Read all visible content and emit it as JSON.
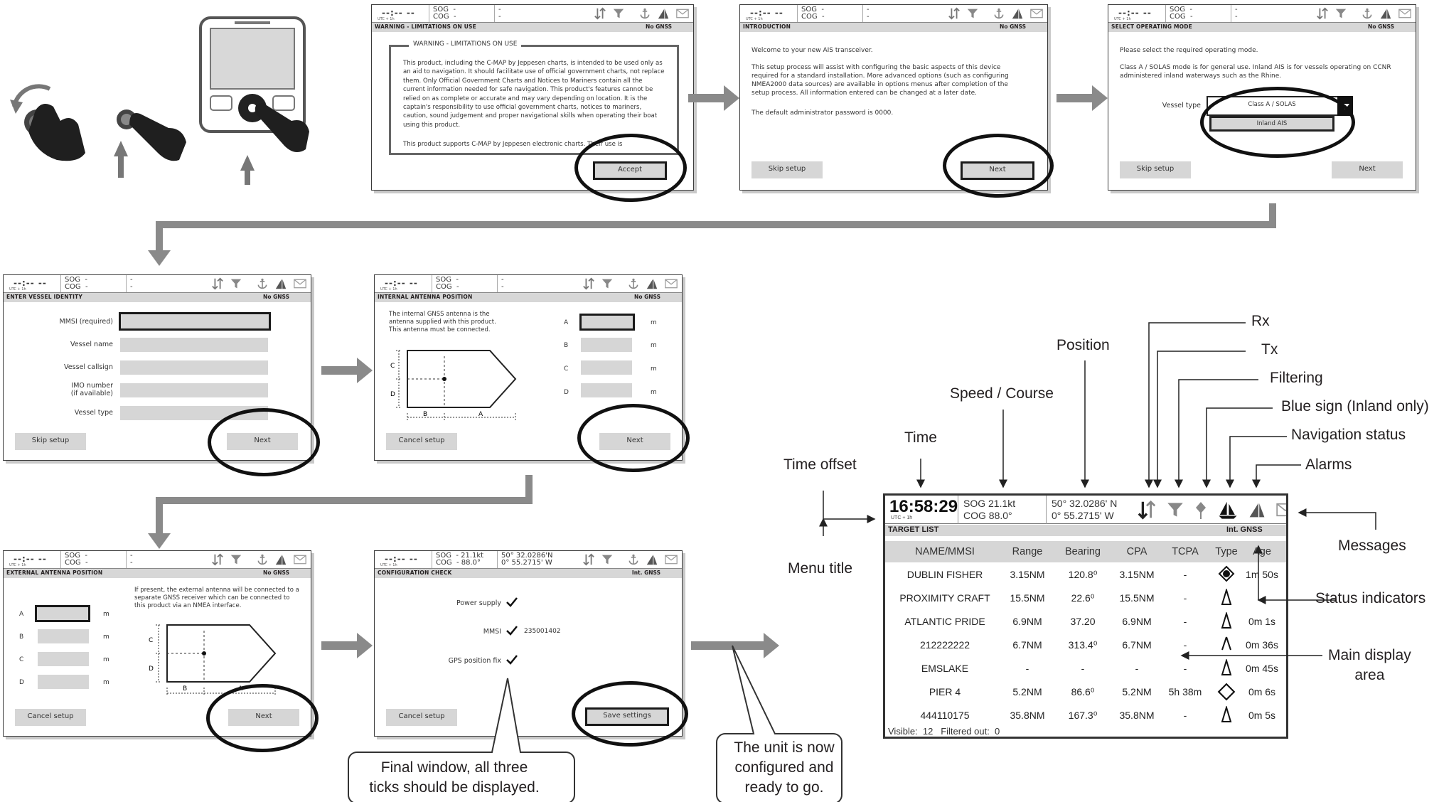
{
  "status_bar": {
    "time_placeholder": "--:-- --",
    "utc": "UTC + 1h",
    "sog": "SOG  -",
    "cog": "COG  -",
    "pos1": "-",
    "pos2": "-",
    "sog_fix": "SOG  - 21.1kt",
    "cog_fix": "COG  - 88.0°",
    "pos1_fix": "50° 32.0286'N",
    "pos2_fix": "0° 55.2715' W"
  },
  "icons": [
    "rx-tx-arrows-icon",
    "filter-icon",
    "anchor-icon",
    "navigation-status-icon",
    "messages-icon"
  ],
  "screens": {
    "warning": {
      "title": "WARNING - LIMITATIONS ON USE",
      "gnss": "No GNSS",
      "box_title": "WARNING - LIMITATIONS ON USE",
      "body": "This product, including the C-MAP by Jeppesen charts, is intended to be used only as an aid to navigation. It should facilitate use of official government charts, not replace them. Only Official Government Charts and Notices to Mariners contain all the current information needed for safe navigation. This product's features cannot be relied on as complete or accurate and may vary depending on location. It is the captain's responsibility to use official government charts, notices to mariners, caution, sound judgement and proper navigational skills when operating their boat using this product.",
      "body2": "This product supports C-MAP by Jeppesen electronic charts. Their use is",
      "accept": "Accept"
    },
    "intro": {
      "title": "INTRODUCTION",
      "gnss": "No GNSS",
      "p1": "Welcome to your new AIS transceiver.",
      "p2": "This setup process will assist with configuring the basic aspects of this device required for a standard installation. More advanced options (such as configuring NMEA2000 data sources) are available in options menus after completion of the setup process. All information entered can be changed at a later date.",
      "p3": "The default administrator password is 0000.",
      "skip": "Skip setup",
      "next": "Next"
    },
    "mode": {
      "title": "SELECT OPERATING MODE",
      "gnss": "No GNSS",
      "p1": "Please select the required operating mode.",
      "p2": "Class A / SOLAS mode is for general use. Inland AIS is for vessels operating on CCNR administered inland waterways such as the Rhine.",
      "vessel_type": "Vessel type",
      "opt1": "Class A / SOLAS",
      "opt2": "Inland AIS",
      "skip": "Skip setup",
      "next": "Next"
    },
    "identity": {
      "title": "ENTER VESSEL IDENTITY",
      "gnss": "No GNSS",
      "mmsi": "MMSI (required)",
      "name": "Vessel name",
      "callsign": "Vessel callsign",
      "imo": "IMO number",
      "imo2": "(if available)",
      "type": "Vessel type",
      "skip": "Skip setup",
      "next": "Next"
    },
    "internal": {
      "title": "INTERNAL ANTENNA POSITION",
      "gnss": "No GNSS",
      "body": "The internal GNSS antenna is the antenna supplied with this product. This antenna must be connected.",
      "letters": [
        "A",
        "B",
        "C",
        "D"
      ],
      "unit": "m",
      "cancel": "Cancel setup",
      "next": "Next"
    },
    "external": {
      "title": "EXTERNAL ANTENNA POSITION",
      "gnss": "No GNSS",
      "body": "If present, the external antenna will be connected to a separate GNSS receiver which can be connected to this product via an NMEA interface.",
      "letters": [
        "A",
        "B",
        "C",
        "D"
      ],
      "unit": "m",
      "cancel": "Cancel setup",
      "next": "Next"
    },
    "config": {
      "title": "CONFIGURATION CHECK",
      "gnss": "Int. GNSS",
      "power": "Power supply",
      "mmsi": "MMSI",
      "mmsi_val": "235001402",
      "gps": "GPS position fix",
      "cancel": "Cancel setup",
      "save": "Save settings"
    }
  },
  "main": {
    "time": "16:58:29",
    "utc": "UTC + 1h",
    "sog": "SOG  21.1kt",
    "cog": "COG  88.0°",
    "lat": "50° 32.0286' N",
    "lon": "0° 55.2715' W",
    "title": "TARGET LIST",
    "gnss": "Int. GNSS",
    "columns": [
      "NAME/MMSI",
      "Range",
      "Bearing",
      "CPA",
      "TCPA",
      "Type",
      "Age"
    ],
    "rows": [
      [
        "DUBLIN FISHER",
        "3.15NM",
        "120.8⁰",
        "3.15NM",
        "-",
        "BS",
        "1m 50s"
      ],
      [
        "PROXIMITY CRAFT",
        "15.5NM",
        "22.6⁰",
        "15.5NM",
        "-",
        "B",
        "-"
      ],
      [
        "ATLANTIC PRIDE",
        "6.9NM",
        "37.20",
        "6.9NM",
        "-",
        "A",
        "0m 1s"
      ],
      [
        "212222222",
        "6.7NM",
        "313.4⁰",
        "6.7NM",
        "-",
        "A2",
        "0m 36s"
      ],
      [
        "EMSLAKE",
        "-",
        "-",
        "-",
        "-",
        "A",
        "0m 45s"
      ],
      [
        "PIER 4",
        "5.2NM",
        "86.6⁰",
        "5.2NM",
        "5h 38m",
        "D",
        "0m 6s"
      ],
      [
        "444110175",
        "35.8NM",
        "167.3⁰",
        "35.8NM",
        "-",
        "B",
        "0m 5s"
      ]
    ],
    "footer": "Visible:  12   Filtered out:  0"
  },
  "annotations": {
    "rx": "Rx",
    "tx": "Tx",
    "position": "Position",
    "filtering": "Filtering",
    "speed_course": "Speed / Course",
    "blue_sign": "Blue sign (Inland only)",
    "time": "Time",
    "nav_status": "Navigation status",
    "time_offset": "Time offset",
    "alarms": "Alarms",
    "messages": "Messages",
    "menu_title": "Menu title",
    "status_indicators": "Status indicators",
    "main_display": "Main display",
    "main_display2": "area"
  },
  "callouts": {
    "final1": "Final window, all three",
    "final2": "ticks should be displayed.",
    "ready1": "The unit is now",
    "ready2": "configured and",
    "ready3": "ready to go."
  }
}
